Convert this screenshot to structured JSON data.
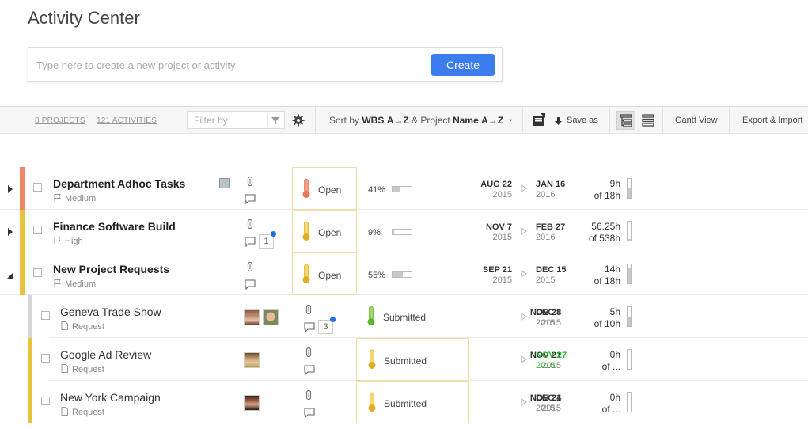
{
  "page": {
    "title": "Activity Center"
  },
  "create": {
    "placeholder": "Type here to create a new project or activity",
    "button_label": "Create"
  },
  "toolbar": {
    "projects_count": "8 PROJECTS",
    "activities_count": "121 ACTIVITIES",
    "filter_placeholder": "Filter by...",
    "sort_prefix": "Sort by",
    "sort_key1": "WBS",
    "sort_dir1": "A→Z",
    "sort_mid": "& Project",
    "sort_key2": "Name",
    "sort_dir2": "A→Z",
    "save_as": "Save as",
    "gantt_view": "Gantt View",
    "export_import": "Export & Import"
  },
  "colors": {
    "accent": "#3b7ded",
    "orange_bar": "#f0866b",
    "yellow_bar": "#e8c23a",
    "gray_bar": "#d6d6d6",
    "green_date": "#2db32d",
    "notify_dot": "#1f6fe0"
  },
  "rows": [
    {
      "type": "project",
      "expanded": false,
      "title": "Department Adhoc Tasks",
      "priority": "Medium",
      "status": "Open",
      "thermo": "red",
      "progress_pct": "41%",
      "progress": 0.41,
      "start_md": "AUG 22",
      "start_yr": "2015",
      "end_md": "JAN 16",
      "end_yr": "2016",
      "hours": "9h",
      "of_hours": "of 18h",
      "hours_fill": 0.5
    },
    {
      "type": "project",
      "expanded": false,
      "title": "Finance Software Build",
      "priority": "High",
      "status": "Open",
      "thermo": "yellow",
      "progress_pct": "9%",
      "progress": 0.09,
      "comment_count": "1",
      "start_md": "NOV 7",
      "start_yr": "2015",
      "end_md": "FEB 27",
      "end_yr": "2016",
      "hours": "56.25h",
      "of_hours": "of 538h",
      "hours_fill": 0.1
    },
    {
      "type": "project",
      "expanded": true,
      "title": "New Project Requests",
      "priority": "Medium",
      "status": "Open",
      "thermo": "yellow",
      "progress_pct": "55%",
      "progress": 0.55,
      "start_md": "SEP 21",
      "start_yr": "2015",
      "end_md": "DEC 15",
      "end_yr": "2015",
      "hours": "14h",
      "of_hours": "of 18h",
      "hours_fill": 0.78
    },
    {
      "type": "activity",
      "title": "Geneva Trade Show",
      "kind": "Request",
      "status": "Submitted",
      "thermo": "green",
      "comment_count": "3",
      "start_md": "NOV 28",
      "start_yr": "2015",
      "end_md": "DEC 4",
      "end_yr": "2015",
      "hours": "5h",
      "of_hours": "of 10h",
      "hours_fill": 0.5
    },
    {
      "type": "activity",
      "title": "Google Ad Review",
      "kind": "Request",
      "status": "Submitted",
      "thermo": "yellow",
      "start_md": "NOV 21",
      "start_yr": "2015",
      "end_md": "NOV 27",
      "end_yr": "2015",
      "hours": "0h",
      "of_hours": "of ...",
      "hours_fill": 0
    },
    {
      "type": "activity",
      "title": "New York Campaign",
      "kind": "Request",
      "status": "Submitted",
      "thermo": "yellow",
      "start_md": "NOV 21",
      "start_yr": "2015",
      "end_md": "DEC 4",
      "end_yr": "2015",
      "hours": "0h",
      "of_hours": "of ...",
      "hours_fill": 0
    }
  ]
}
